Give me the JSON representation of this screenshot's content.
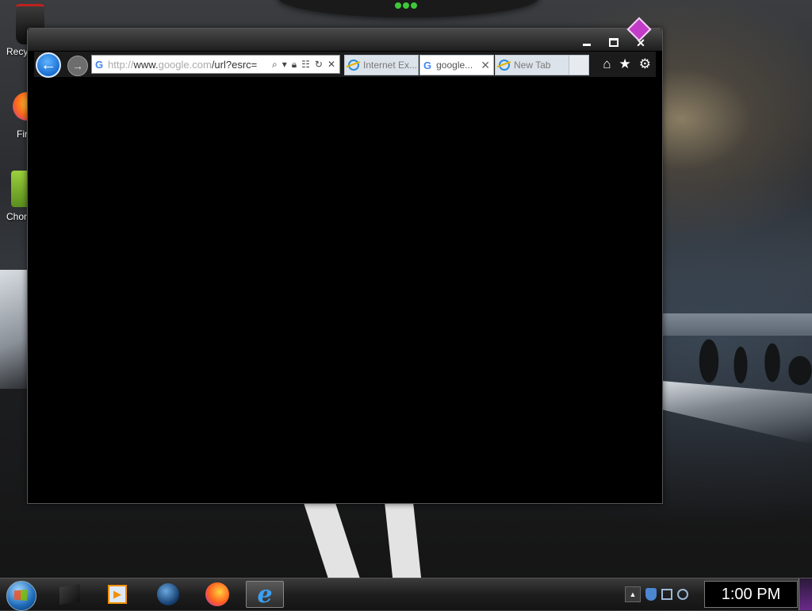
{
  "desktop": {
    "icons": [
      {
        "label": "Recy"
      },
      {
        "label": "Fir"
      },
      {
        "label": "Chor"
      }
    ]
  },
  "browser": {
    "address": {
      "scheme": "http://",
      "prefix": "www.",
      "host": "google.com",
      "path": "/url?esrc="
    },
    "tabs": [
      {
        "label": "Internet Ex...",
        "icon": "ie-icon",
        "active": false
      },
      {
        "label": "google...",
        "icon": "google-icon",
        "active": true
      },
      {
        "label": "New Tab",
        "icon": "ie-icon",
        "active": false
      }
    ],
    "tab_close_glyph": "✕",
    "commands": {
      "home": "home-icon",
      "favorites": "star-icon",
      "tools": "gear-icon"
    }
  },
  "taskbar": {
    "pinned": [
      {
        "name": "cube-app-icon"
      },
      {
        "name": "media-player-icon"
      },
      {
        "name": "globe-app-icon"
      },
      {
        "name": "firefox-icon"
      },
      {
        "name": "internet-explorer-icon",
        "active": true
      }
    ],
    "clock": "1:00 PM"
  },
  "colors": {
    "accent": "#1a6ed0",
    "window_bg": "#000000",
    "diamond": "#c33cc8"
  }
}
